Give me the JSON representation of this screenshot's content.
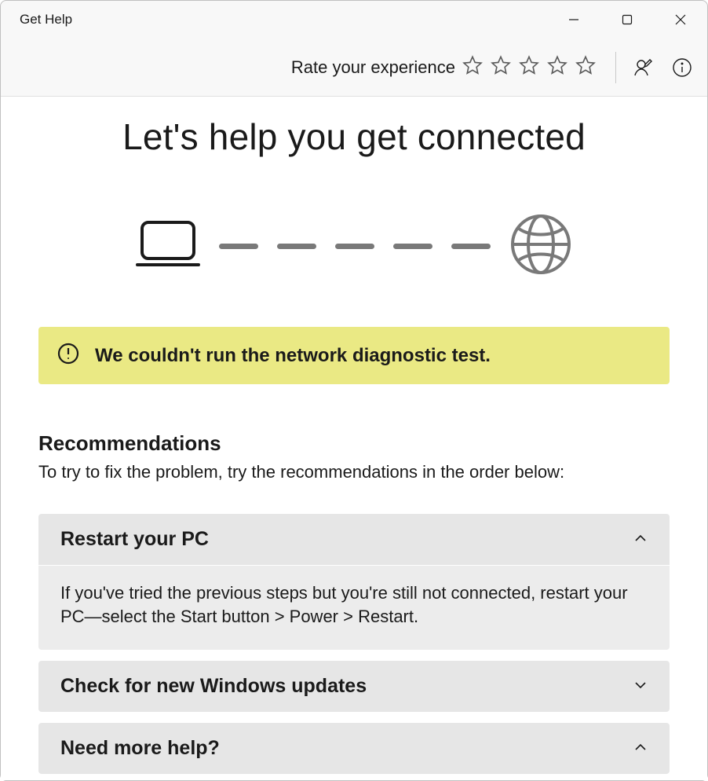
{
  "window": {
    "title": "Get Help"
  },
  "toolbar": {
    "rate_label": "Rate your experience"
  },
  "page": {
    "title": "Let's help you get connected"
  },
  "alert": {
    "text": "We couldn't run the network diagnostic test."
  },
  "recommendations": {
    "heading": "Recommendations",
    "subheading": "To try to fix the problem, try the recommendations in the order below:",
    "items": [
      {
        "title": "Restart your PC",
        "body": "If you've tried the previous steps but you're still not connected, restart your PC—select the Start button > Power > Restart.",
        "expanded": true
      },
      {
        "title": "Check for new Windows updates",
        "body": "",
        "expanded": false
      },
      {
        "title": "Need more help?",
        "body": "",
        "expanded": true
      }
    ]
  }
}
